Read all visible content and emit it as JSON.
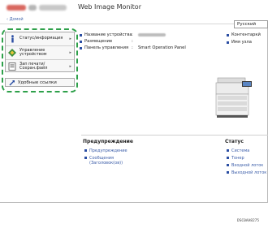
{
  "header": {
    "app_title": "Web Image Monitor",
    "breadcrumb": "‹ Домой",
    "language": "Русский"
  },
  "sidebar": {
    "items": [
      {
        "label": "Статус/информация",
        "icon": "info-icon"
      },
      {
        "label": "Управление устройством",
        "icon": "device-management-icon"
      },
      {
        "label": "Зап печати/Сохран.файл",
        "icon": "print-jobs-icon"
      }
    ],
    "links_label": "Удобные ссылки",
    "links_icon": "link-icon"
  },
  "device_info": {
    "rows": [
      {
        "label": "Название устройства",
        "sep": ":"
      },
      {
        "label": "Размещение",
        "sep": ":"
      },
      {
        "label": "Панель управления",
        "sep": ":",
        "value": "Smart Operation Panel"
      }
    ],
    "right_items": [
      "Контентаркй",
      "Имя узла"
    ]
  },
  "warnings": {
    "title": "Предупреждение",
    "items": [
      "Предупреждение",
      "Сообщения (Заголовок(ов))"
    ]
  },
  "status": {
    "title": "Статус",
    "items": [
      "Система",
      "Тонер",
      "Входной лоток",
      "Выходной лоток"
    ]
  },
  "footer_id": "DSC0AA8275",
  "colors": {
    "highlight": "#2ea04a",
    "link": "#3a5ca8",
    "bullet": "#2b4ea3"
  }
}
